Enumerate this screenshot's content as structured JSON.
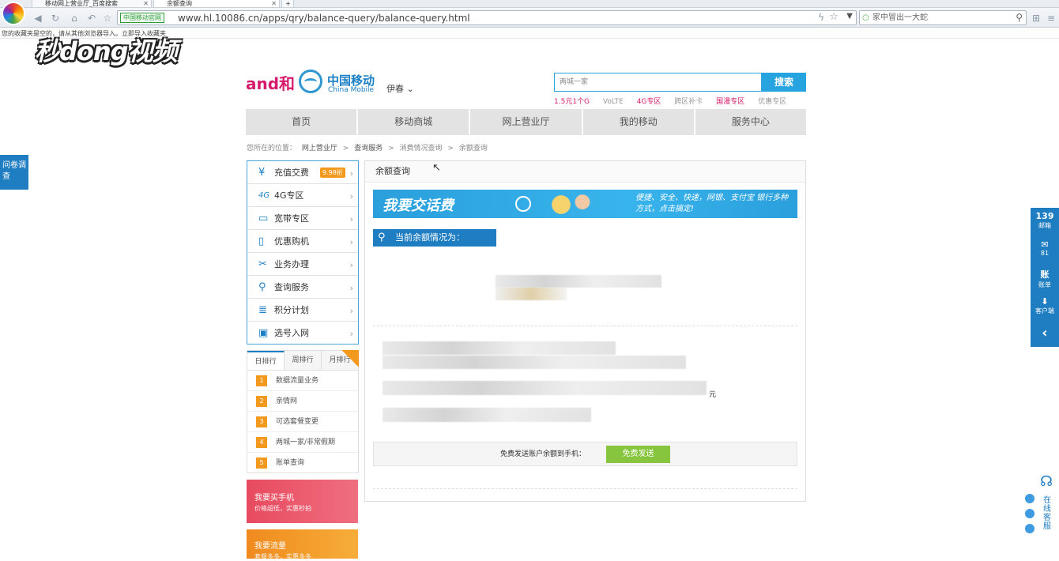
{
  "browser": {
    "tabs": [
      {
        "label": "移动网上营业厅_百度搜索"
      },
      {
        "label": "余额查询"
      }
    ],
    "new_tab": "+",
    "url_badge": "中国移动官网",
    "url": "www.hl.10086.cn/apps/qry/balance-query/balance-query.html",
    "search_placeholder": "家中冒出一大蛇",
    "bookmark_bar_text": "您的收藏夹是空的，请从其他浏览器导入。立即导入收藏夹",
    "watermark": "秒dong视频"
  },
  "header": {
    "brand_he": "and和",
    "brand_cn": "中国移动",
    "brand_en": "China Mobile",
    "city": "伊春 ⌄",
    "search_placeholder": "两城一家",
    "search_button": "搜索",
    "quick_links": [
      "1.5元1个G",
      "VoLTE",
      "4G专区",
      "跨区补卡",
      "国漫专区",
      "优惠专区"
    ]
  },
  "nav": [
    "首页",
    "移动商城",
    "网上营业厅",
    "我的移动",
    "服务中心"
  ],
  "breadcrumb": [
    "您所在的位置：",
    "网上营业厅",
    ">",
    "查询服务",
    ">",
    "消费情况查询",
    ">",
    "余额查询"
  ],
  "sidebar": {
    "items": [
      {
        "label": "充值交费",
        "icon": "¥",
        "badge": "9.98折"
      },
      {
        "label": "4G专区",
        "icon": "4G"
      },
      {
        "label": "宽带专区",
        "icon": "▭"
      },
      {
        "label": "优惠购机",
        "icon": "▯"
      },
      {
        "label": "业务办理",
        "icon": "✂"
      },
      {
        "label": "查询服务",
        "icon": "⚲"
      },
      {
        "label": "积分计划",
        "icon": "≣"
      },
      {
        "label": "选号入网",
        "icon": "▣"
      }
    ],
    "rank_tabs": [
      "日排行",
      "周排行",
      "月排行"
    ],
    "rank_items": [
      {
        "num": "1",
        "label": "数据流量业务"
      },
      {
        "num": "2",
        "label": "亲情网"
      },
      {
        "num": "3",
        "label": "可选套餐变更"
      },
      {
        "num": "4",
        "label": "两城一家/非常假期"
      },
      {
        "num": "5",
        "label": "账单查询"
      }
    ],
    "promo1": {
      "title": "我要买手机",
      "sub": "价格超低，实惠秒拍"
    },
    "promo2": {
      "title": "我要流量",
      "sub": "套餐多多，实惠多多"
    }
  },
  "panel": {
    "title": "余额查询",
    "ad_title": "我要交话费",
    "ad_copy": "便捷、安全、快速，网银、支付宝 银行多种方式，点击搞定!",
    "balance_heading": "当前余额情况为：",
    "currency_unit": "元",
    "send_label": "免费发送账户余额到手机：",
    "send_button": "免费发送"
  },
  "floating": {
    "survey": "问卷调查",
    "dock": [
      {
        "big": "139",
        "small": "邮箱"
      },
      {
        "big": "✉",
        "small": "81"
      },
      {
        "big": "账",
        "small": "账单"
      },
      {
        "big": "⬇",
        "small": "客户端"
      },
      {
        "big": "‹",
        "small": ""
      }
    ],
    "service": "在线客服"
  },
  "colors": {
    "brand_blue": "#1f7dc1",
    "accent_magenta": "#d61a6c",
    "send_green": "#86c53d",
    "promo_orange": "#f39a1e"
  }
}
